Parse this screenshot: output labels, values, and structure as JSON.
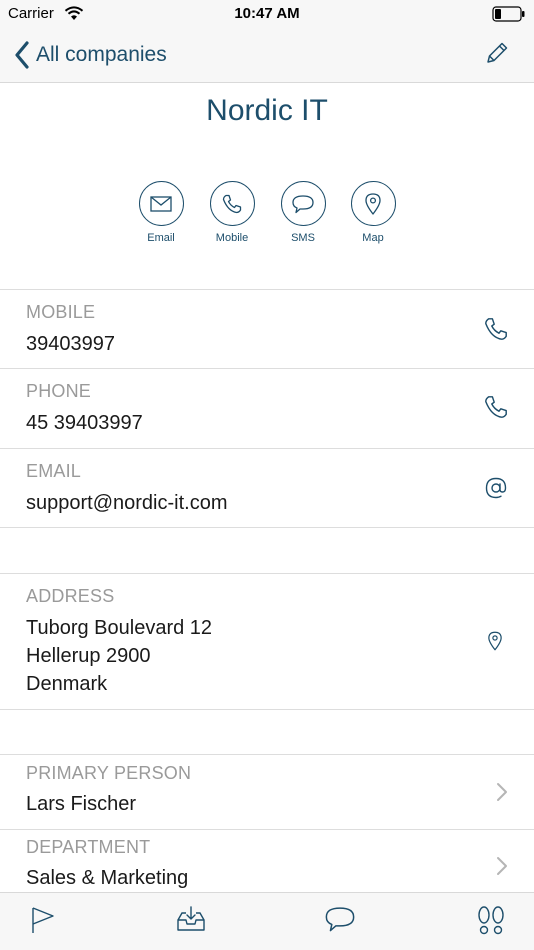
{
  "status": {
    "carrier": "Carrier",
    "time": "10:47 AM"
  },
  "nav": {
    "back_label": "All companies"
  },
  "company": {
    "name": "Nordic IT"
  },
  "actions": [
    {
      "label": "Email",
      "icon": "envelope-icon"
    },
    {
      "label": "Mobile",
      "icon": "phone-icon"
    },
    {
      "label": "SMS",
      "icon": "chat-bubble-icon"
    },
    {
      "label": "Map",
      "icon": "map-pin-icon"
    }
  ],
  "contact": {
    "mobile": {
      "label": "MOBILE",
      "value": "39403997"
    },
    "phone": {
      "label": "PHONE",
      "value": "45 39403997"
    },
    "email": {
      "label": "EMAIL",
      "value": "support@nordic-it.com"
    }
  },
  "address": {
    "label": "ADDRESS",
    "line1": "Tuborg Boulevard 12",
    "line2": "Hellerup 2900",
    "line3": "Denmark"
  },
  "relations": {
    "primary_person": {
      "label": "PRIMARY PERSON",
      "value": "Lars Fischer"
    },
    "department": {
      "label": "DEPARTMENT",
      "value": "Sales & Marketing"
    }
  },
  "tabbar": [
    "flag-icon",
    "inbox-download-icon",
    "chat-bubble-icon",
    "footprints-icon"
  ],
  "colors": {
    "accent": "#1d4e6b",
    "label_gray": "#9a9a9a",
    "bar_bg": "#f7f7f7"
  }
}
